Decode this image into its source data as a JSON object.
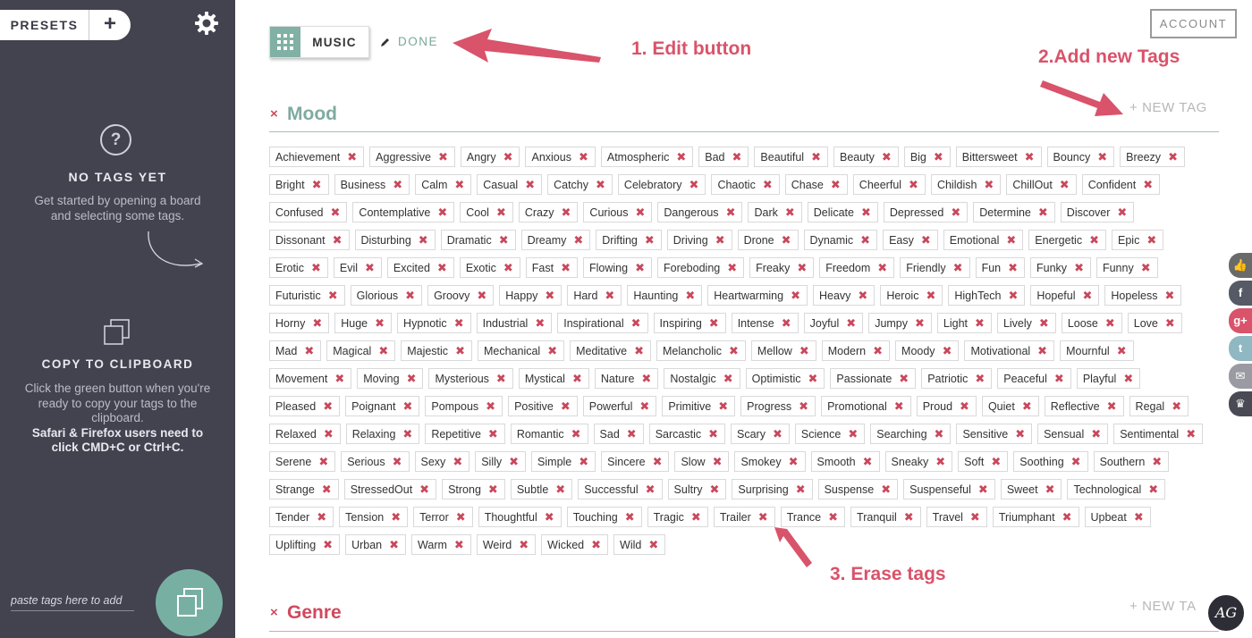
{
  "sidebar": {
    "presets_label": "PRESETS",
    "add_label": "+",
    "help_glyph": "?",
    "no_tags_title": "NO TAGS YET",
    "no_tags_text": "Get started by opening a board and selecting some tags.",
    "copy_title": "COPY TO CLIPBOARD",
    "copy_text": "Click the green button when you're ready to copy your tags to the clipboard.",
    "copy_note": "Safari & Firefox users need to click CMD+C or Ctrl+C.",
    "paste_placeholder": "paste tags here to add"
  },
  "header": {
    "board_label": "MUSIC",
    "done_label": "DONE",
    "account_label": "ACCOUNT"
  },
  "sections": {
    "mood": {
      "close": "×",
      "title": "Mood",
      "new_tag": "+ NEW TAG"
    },
    "genre": {
      "close": "×",
      "title": "Genre",
      "new_tag": "+ NEW TA"
    }
  },
  "tags": [
    "Achievement",
    "Aggressive",
    "Angry",
    "Anxious",
    "Atmospheric",
    "Bad",
    "Beautiful",
    "Beauty",
    "Big",
    "Bittersweet",
    "Bouncy",
    "Breezy",
    "Bright",
    "Business",
    "Calm",
    "Casual",
    "Catchy",
    "Celebratory",
    "Chaotic",
    "Chase",
    "Cheerful",
    "Childish",
    "ChillOut",
    "Confident",
    "Confused",
    "Contemplative",
    "Cool",
    "Crazy",
    "Curious",
    "Dangerous",
    "Dark",
    "Delicate",
    "Depressed",
    "Determine",
    "Discover",
    "Dissonant",
    "Disturbing",
    "Dramatic",
    "Dreamy",
    "Drifting",
    "Driving",
    "Drone",
    "Dynamic",
    "Easy",
    "Emotional",
    "Energetic",
    "Epic",
    "Erotic",
    "Evil",
    "Excited",
    "Exotic",
    "Fast",
    "Flowing",
    "Foreboding",
    "Freaky",
    "Freedom",
    "Friendly",
    "Fun",
    "Funky",
    "Funny",
    "Futuristic",
    "Glorious",
    "Groovy",
    "Happy",
    "Hard",
    "Haunting",
    "Heartwarming",
    "Heavy",
    "Heroic",
    "HighTech",
    "Hopeful",
    "Hopeless",
    "Horny",
    "Huge",
    "Hypnotic",
    "Industrial",
    "Inspirational",
    "Inspiring",
    "Intense",
    "Joyful",
    "Jumpy",
    "Light",
    "Lively",
    "Loose",
    "Love",
    "Mad",
    "Magical",
    "Majestic",
    "Mechanical",
    "Meditative",
    "Melancholic",
    "Mellow",
    "Modern",
    "Moody",
    "Motivational",
    "Mournful",
    "Movement",
    "Moving",
    "Mysterious",
    "Mystical",
    "Nature",
    "Nostalgic",
    "Optimistic",
    "Passionate",
    "Patriotic",
    "Peaceful",
    "Playful",
    "Pleased",
    "Poignant",
    "Pompous",
    "Positive",
    "Powerful",
    "Primitive",
    "Progress",
    "Promotional",
    "Proud",
    "Quiet",
    "Reflective",
    "Regal",
    "Relaxed",
    "Relaxing",
    "Repetitive",
    "Romantic",
    "Sad",
    "Sarcastic",
    "Scary",
    "Science",
    "Searching",
    "Sensitive",
    "Sensual",
    "Sentimental",
    "Serene",
    "Serious",
    "Sexy",
    "Silly",
    "Simple",
    "Sincere",
    "Slow",
    "Smokey",
    "Smooth",
    "Sneaky",
    "Soft",
    "Soothing",
    "Southern",
    "Strange",
    "StressedOut",
    "Strong",
    "Subtle",
    "Successful",
    "Sultry",
    "Surprising",
    "Suspense",
    "Suspenseful",
    "Sweet",
    "Technological",
    "Tender",
    "Tension",
    "Terror",
    "Thoughtful",
    "Touching",
    "Tragic",
    "Trailer",
    "Trance",
    "Tranquil",
    "Travel",
    "Triumphant",
    "Upbeat",
    "Uplifting",
    "Urban",
    "Warm",
    "Weird",
    "Wicked",
    "Wild"
  ],
  "tag_remove_glyph": "✖",
  "social": [
    {
      "name": "like",
      "label": "👍",
      "color": "#6a6a6a"
    },
    {
      "name": "facebook",
      "label": "f",
      "color": "#555a66"
    },
    {
      "name": "google-plus",
      "label": "g+",
      "color": "#d9536a"
    },
    {
      "name": "twitter",
      "label": "t",
      "color": "#8fb8c2"
    },
    {
      "name": "email",
      "label": "✉",
      "color": "#9a9aa2"
    },
    {
      "name": "crown",
      "label": "♛",
      "color": "#4a4a55"
    }
  ],
  "annotations": {
    "edit": "1. Edit button",
    "add": "2.Add new Tags",
    "erase": "3. Erase tags"
  },
  "avatar_text": "AG",
  "colors": {
    "sidebar_bg": "#43424f",
    "accent_green": "#7fab9f",
    "accent_red": "#cf4a5e",
    "annotation": "#d9536a"
  }
}
